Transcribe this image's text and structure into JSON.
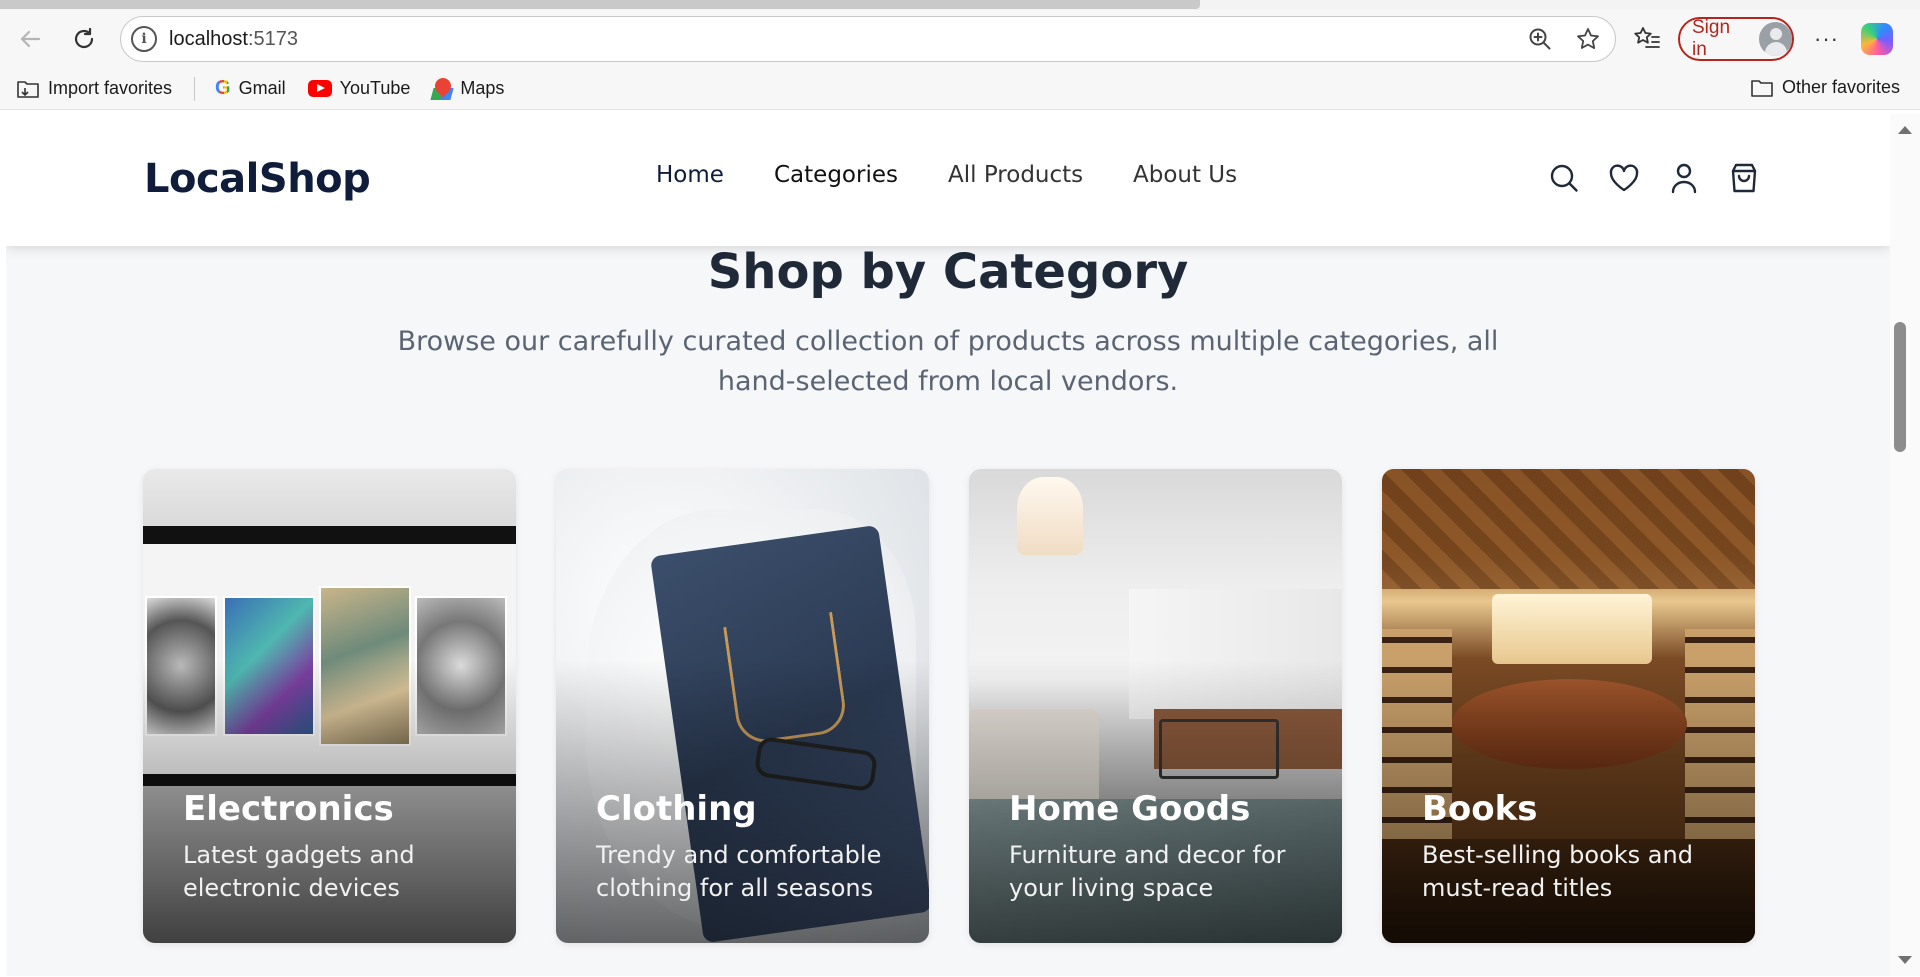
{
  "browser": {
    "url_host": "localhost",
    "url_port": ":5173",
    "sign_in_label": "Sign in",
    "more_label": "···",
    "bookmarks": {
      "import_label": "Import favorites",
      "gmail_label": "Gmail",
      "youtube_label": "YouTube",
      "maps_label": "Maps",
      "other_label": "Other favorites"
    }
  },
  "site": {
    "logo": "LocalShop",
    "nav": {
      "home": "Home",
      "categories": "Categories",
      "all_products": "All Products",
      "about": "About Us"
    }
  },
  "section": {
    "title": "Shop by Category",
    "subtitle": "Browse our carefully curated collection of products across multiple categories, all hand-selected from local vendors."
  },
  "categories": [
    {
      "title": "Electronics",
      "description": "Latest gadgets and electronic devices"
    },
    {
      "title": "Clothing",
      "description": "Trendy and comfortable clothing for all seasons"
    },
    {
      "title": "Home Goods",
      "description": "Furniture and decor for your living space"
    },
    {
      "title": "Books",
      "description": "Best-selling books and must-read titles"
    }
  ]
}
